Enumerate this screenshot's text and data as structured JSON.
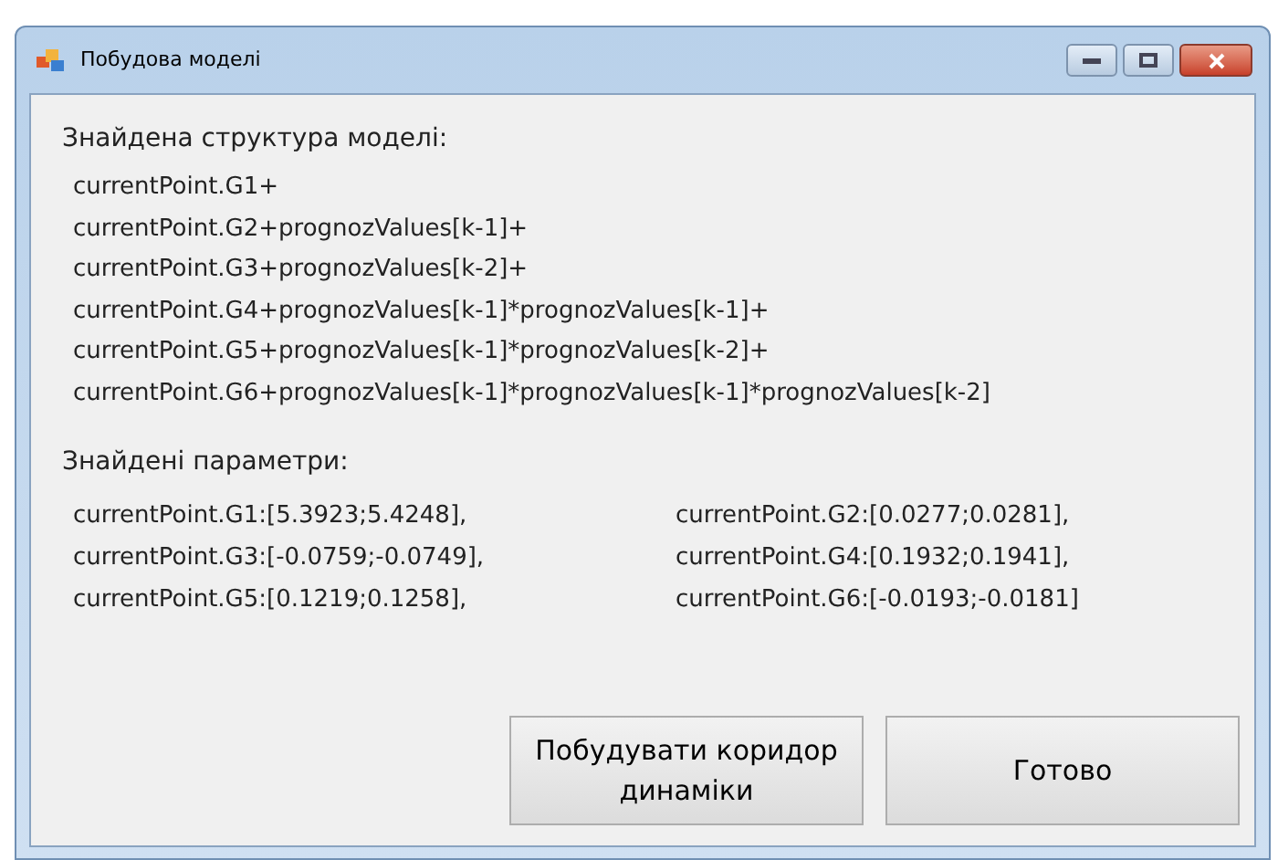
{
  "window": {
    "title": "Побудова моделі"
  },
  "structure": {
    "heading": "Знайдена структура моделі:",
    "lines": [
      "currentPoint.G1+",
      "currentPoint.G2+prognozValues[k-1]+",
      "currentPoint.G3+prognozValues[k-2]+",
      "currentPoint.G4+prognozValues[k-1]*prognozValues[k-1]+",
      "currentPoint.G5+prognozValues[k-1]*prognozValues[k-2]+",
      "currentPoint.G6+prognozValues[k-1]*prognozValues[k-1]*prognozValues[k-2]"
    ]
  },
  "parameters": {
    "heading": "Знайдені параметри:",
    "items": [
      "currentPoint.G1:[5.3923;5.4248],",
      "currentPoint.G2:[0.0277;0.0281],",
      "currentPoint.G3:[-0.0759;-0.0749],",
      "currentPoint.G4:[0.1932;0.1941],",
      "currentPoint.G5:[0.1219;0.1258],",
      "currentPoint.G6:[-0.0193;-0.0181]"
    ]
  },
  "buttons": [
    "Побудувати коридор динаміки",
    "Готово"
  ]
}
